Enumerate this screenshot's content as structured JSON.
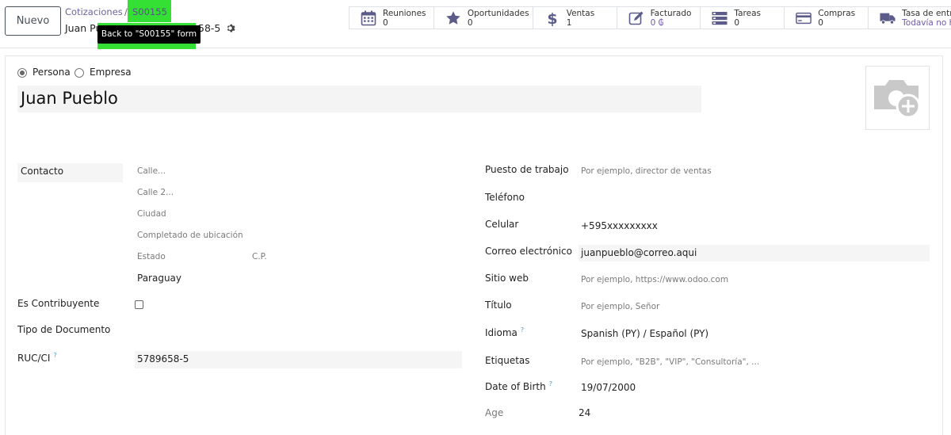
{
  "control_panel": {
    "new_button": "Nuevo",
    "breadcrumb_parent": "Cotizaciones",
    "breadcrumb_separator": "/",
    "breadcrumb_current": "S00155",
    "record_title_start": "Juan Pu",
    "record_title_end": "58-5",
    "tooltip": "Back to \"S00155\" form"
  },
  "smart_buttons": [
    {
      "icon": "calendar-icon",
      "label": "Reuniones",
      "value": "0"
    },
    {
      "icon": "star-icon",
      "label": "Oportunidades",
      "value": "0"
    },
    {
      "icon": "dollar-icon",
      "label": "Ventas",
      "value": "1"
    },
    {
      "icon": "invoice-edit-icon",
      "label": "Facturado",
      "value": "0 ₲"
    },
    {
      "icon": "tasks-icon",
      "label": "Tareas",
      "value": "0"
    },
    {
      "icon": "credit-card-icon",
      "label": "Compras",
      "value": "0"
    },
    {
      "icon": "truck-icon",
      "label": "Tasa de entr",
      "value": "Todavía no h"
    }
  ],
  "form": {
    "company_type": {
      "person_label": "Persona",
      "company_label": "Empresa",
      "selected": "Persona"
    },
    "name": "Juan Pueblo",
    "left": {
      "contact_label": "Contacto",
      "street_placeholder": "Calle...",
      "street2_placeholder": "Calle 2...",
      "city_placeholder": "Ciudad",
      "location_placeholder": "Completado de ubicación",
      "state_placeholder": "Estado",
      "zip_placeholder": "C.P.",
      "country": "Paraguay",
      "taxpayer_label": "Es Contribuyente",
      "taxpayer_checked": false,
      "doc_type_label": "Tipo de Documento",
      "ruc_label": "RUC/CI",
      "ruc_help": "?",
      "ruc_value": "5789658-5"
    },
    "right": {
      "job_label": "Puesto de trabajo",
      "job_placeholder": "Por ejemplo, director de ventas",
      "phone_label": "Teléfono",
      "mobile_label": "Celular",
      "mobile_value": "+595xxxxxxxxx",
      "email_label": "Correo electrónico",
      "email_value": "juanpueblo@correo.aqui",
      "website_label": "Sitio web",
      "website_placeholder": "Por ejemplo, https://www.odoo.com",
      "title_label": "Título",
      "title_placeholder": "Por ejemplo, Señor",
      "lang_label": "Idioma",
      "lang_help": "?",
      "lang_value": "Spanish (PY) / Español (PY)",
      "tags_label": "Etiquetas",
      "tags_placeholder": "Por ejemplo, \"B2B\", \"VIP\", \"Consultoría\", ...",
      "birth_label": "Date of Birth",
      "birth_help": "?",
      "birth_value": "19/07/2000",
      "age_label": "Age",
      "age_value": "24"
    }
  },
  "colors": {
    "accent": "#71639e",
    "highlight": "#33e033",
    "icon": "#5c5c8a"
  }
}
